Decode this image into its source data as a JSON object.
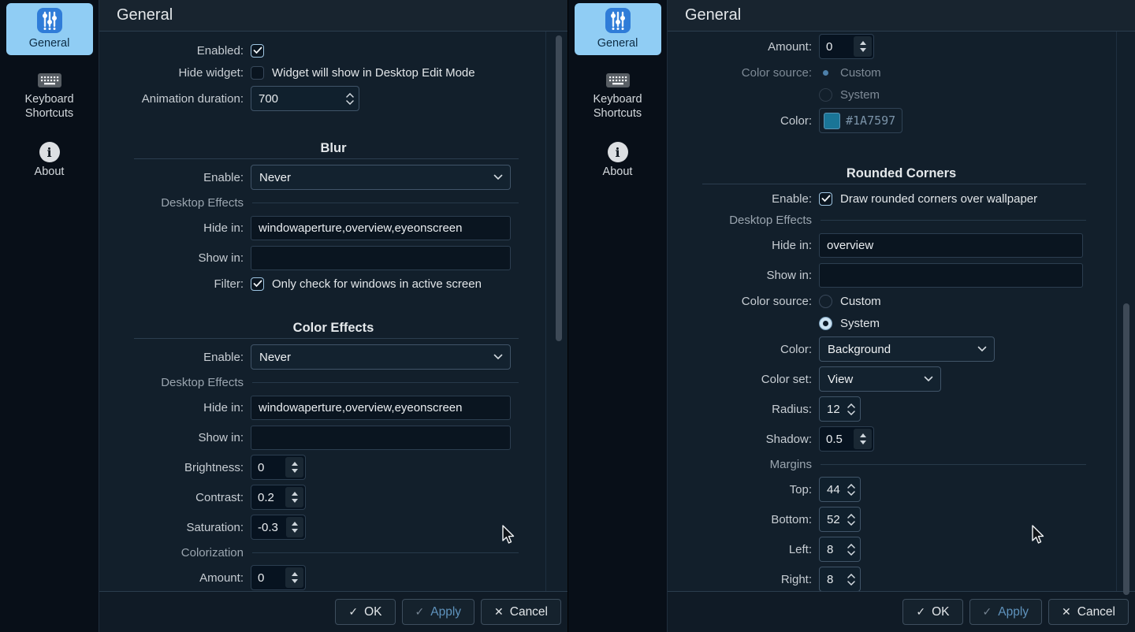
{
  "colors": {
    "accent": "#3daee9",
    "sidebar_selected_bg": "#90CDF4",
    "swatch": "#1A7597"
  },
  "sidebar": {
    "items": [
      {
        "label": "General",
        "icon": "sliders-app-icon"
      },
      {
        "label": "Keyboard Shortcuts",
        "icon": "keyboard-icon"
      },
      {
        "label": "About",
        "icon": "info-icon"
      }
    ]
  },
  "footer": {
    "ok": "OK",
    "ok_icon": "✓",
    "apply": "Apply",
    "apply_icon": "✓",
    "cancel": "Cancel",
    "cancel_icon": "✕"
  },
  "left": {
    "title": "General",
    "enabled_label": "Enabled:",
    "hide_widget_label": "Hide widget:",
    "hide_widget_text": "Widget will show in Desktop Edit Mode",
    "animation_label": "Animation duration:",
    "animation_value": "700",
    "blur": {
      "header": "Blur",
      "enable_label": "Enable:",
      "enable_value": "Never",
      "desktop_effects": "Desktop Effects",
      "hide_in_label": "Hide in:",
      "hide_in_value": "windowaperture,overview,eyeonscreen",
      "show_in_label": "Show in:",
      "show_in_value": "",
      "filter_label": "Filter:",
      "filter_text": "Only check for windows in active screen"
    },
    "color_effects": {
      "header": "Color Effects",
      "enable_label": "Enable:",
      "enable_value": "Never",
      "desktop_effects": "Desktop Effects",
      "hide_in_label": "Hide in:",
      "hide_in_value": "windowaperture,overview,eyeonscreen",
      "show_in_label": "Show in:",
      "show_in_value": "",
      "brightness_label": "Brightness:",
      "brightness_value": "0",
      "contrast_label": "Contrast:",
      "contrast_value": "0.2",
      "saturation_label": "Saturation:",
      "saturation_value": "-0.3",
      "colorization": "Colorization",
      "amount_label": "Amount:",
      "amount_value": "0"
    }
  },
  "right": {
    "title": "General",
    "amount_label": "Amount:",
    "amount_value": "0",
    "color_source_label": "Color source:",
    "custom_label": "Custom",
    "system_label": "System",
    "color_label": "Color:",
    "color_hex": "#1A7597",
    "rounded": {
      "header": "Rounded Corners",
      "enable_label": "Enable:",
      "enable_text": "Draw rounded corners over wallpaper",
      "desktop_effects": "Desktop Effects",
      "hide_in_label": "Hide in:",
      "hide_in_value": "overview",
      "show_in_label": "Show in:",
      "show_in_value": "",
      "color_source_label": "Color source:",
      "custom_label": "Custom",
      "system_label": "System",
      "color_label": "Color:",
      "color_value": "Background",
      "color_set_label": "Color set:",
      "color_set_value": "View",
      "radius_label": "Radius:",
      "radius_value": "12",
      "shadow_label": "Shadow:",
      "shadow_value": "0.5",
      "margins": "Margins",
      "top_label": "Top:",
      "top_value": "44",
      "bottom_label": "Bottom:",
      "bottom_value": "52",
      "left_label": "Left:",
      "left_value": "8",
      "right_label": "Right:",
      "right_value": "8"
    }
  }
}
